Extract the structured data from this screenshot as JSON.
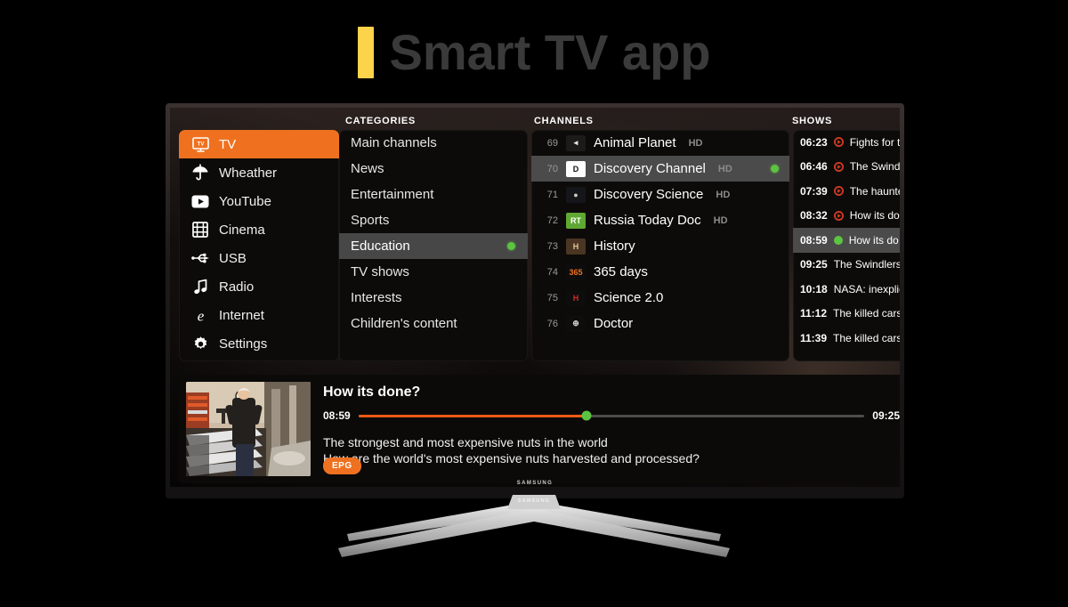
{
  "page": {
    "title": "Smart TV app",
    "accent_yellow": "#fcd34a",
    "title_color": "#3a3a3a"
  },
  "tv": {
    "brand": "SAMSUNG",
    "accent_orange": "#ef7120",
    "status_green": "#5cc442",
    "progress_orange": "#ef5a14"
  },
  "headers": {
    "categories": "CATEGORIES",
    "channels": "CHANNELS",
    "shows": "SHOWS"
  },
  "sidebar": {
    "items": [
      {
        "label": "TV",
        "icon": "tv-icon",
        "active": true
      },
      {
        "label": "Wheather",
        "icon": "umbrella-icon",
        "active": false
      },
      {
        "label": "YouTube",
        "icon": "youtube-icon",
        "active": false
      },
      {
        "label": "Cinema",
        "icon": "film-icon",
        "active": false
      },
      {
        "label": "USB",
        "icon": "usb-icon",
        "active": false
      },
      {
        "label": "Radio",
        "icon": "music-note-icon",
        "active": false
      },
      {
        "label": "Internet",
        "icon": "internet-explorer-icon",
        "active": false
      },
      {
        "label": "Settings",
        "icon": "gear-icon",
        "active": false
      }
    ]
  },
  "categories": {
    "items": [
      {
        "label": "Main channels",
        "active": false,
        "dot": false
      },
      {
        "label": "News",
        "active": false,
        "dot": false
      },
      {
        "label": "Entertainment",
        "active": false,
        "dot": false
      },
      {
        "label": "Sports",
        "active": false,
        "dot": false
      },
      {
        "label": "Education",
        "active": true,
        "dot": true
      },
      {
        "label": "TV shows",
        "active": false,
        "dot": false
      },
      {
        "label": "Interests",
        "active": false,
        "dot": false
      },
      {
        "label": "Children's content",
        "active": false,
        "dot": false
      }
    ]
  },
  "channels": {
    "items": [
      {
        "number": "69",
        "name": "Animal Planet",
        "hd": "HD",
        "active": false,
        "dot": false,
        "logo": "animal-planet-logo",
        "logo_bg": "#1b1b1b",
        "logo_fg": "#e8e8e8",
        "logo_text": "◂"
      },
      {
        "number": "70",
        "name": "Discovery Channel",
        "hd": "HD",
        "active": true,
        "dot": true,
        "logo": "discovery-channel-logo",
        "logo_bg": "#ffffff",
        "logo_fg": "#111111",
        "logo_text": "D"
      },
      {
        "number": "71",
        "name": "Discovery Science",
        "hd": "HD",
        "active": false,
        "dot": false,
        "logo": "discovery-science-logo",
        "logo_bg": "#15161a",
        "logo_fg": "#c9c9c9",
        "logo_text": "●"
      },
      {
        "number": "72",
        "name": "Russia Today  Doc",
        "hd": "HD",
        "active": false,
        "dot": false,
        "logo": "russia-today-doc-logo",
        "logo_bg": "#5fa832",
        "logo_fg": "#ffffff",
        "logo_text": "RT"
      },
      {
        "number": "73",
        "name": "History",
        "hd": "",
        "active": false,
        "dot": false,
        "logo": "history-logo",
        "logo_bg": "#4a3622",
        "logo_fg": "#e0c49a",
        "logo_text": "H"
      },
      {
        "number": "74",
        "name": "365 days",
        "hd": "",
        "active": false,
        "dot": false,
        "logo": "365-days-logo",
        "logo_bg": "#0d0d0d",
        "logo_fg": "#ef7120",
        "logo_text": "365"
      },
      {
        "number": "75",
        "name": "Science 2.0",
        "hd": "",
        "active": false,
        "dot": false,
        "logo": "science-20-logo",
        "logo_bg": "#0d0d0d",
        "logo_fg": "#d22a22",
        "logo_text": "H"
      },
      {
        "number": "76",
        "name": "Doctor",
        "hd": "",
        "active": false,
        "dot": false,
        "logo": "doctor-logo",
        "logo_bg": "#0d0d0d",
        "logo_fg": "#dcdcdc",
        "logo_text": "⊕"
      }
    ]
  },
  "shows": {
    "items": [
      {
        "time": "06:23",
        "title": "Fights for t",
        "marker": "record",
        "active": false
      },
      {
        "time": "06:46",
        "title": "The Swindl",
        "marker": "record",
        "active": false
      },
      {
        "time": "07:39",
        "title": "The haunte",
        "marker": "record",
        "active": false
      },
      {
        "time": "08:32",
        "title": "How its do",
        "marker": "record",
        "active": false
      },
      {
        "time": "08:59",
        "title": "How its do",
        "marker": "live",
        "active": true
      },
      {
        "time": "09:25",
        "title": "The Swindlers",
        "marker": "none",
        "active": false
      },
      {
        "time": "10:18",
        "title": "NASA: inexplic",
        "marker": "none",
        "active": false
      },
      {
        "time": "11:12",
        "title": "The killed cars",
        "marker": "none",
        "active": false
      },
      {
        "time": "11:39",
        "title": "The killed cars",
        "marker": "none",
        "active": false
      }
    ]
  },
  "info": {
    "title": "How its done?",
    "start_time": "08:59",
    "end_time": "09:25",
    "progress_percent": 45,
    "description_line1": "The strongest and most expensive nuts in the world",
    "description_line2": "How are the world's most expensive nuts harvested and processed?",
    "badge": "EPG",
    "thumbnail_alt": "workshop-knife-factory"
  }
}
